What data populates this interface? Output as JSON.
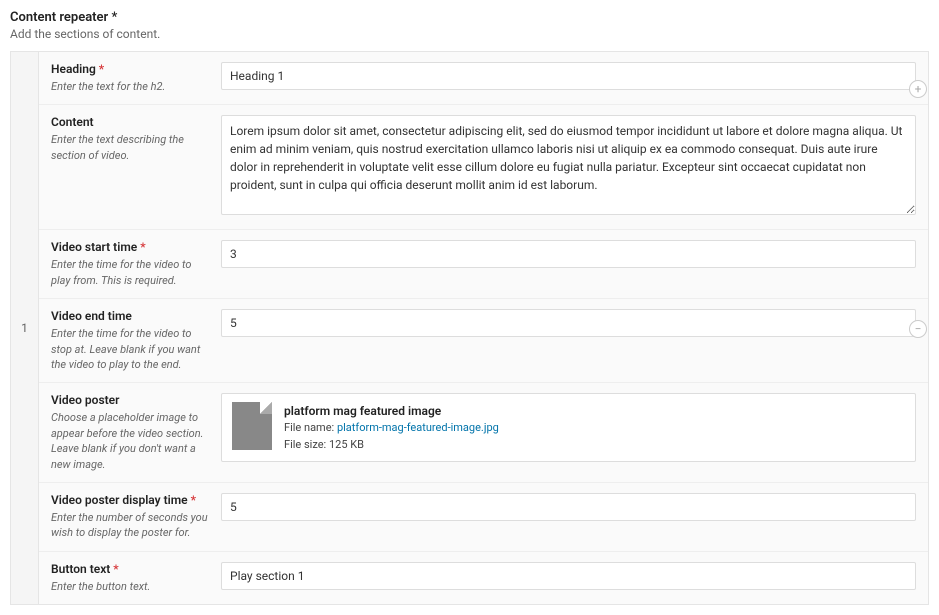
{
  "section": {
    "title": "Content repeater",
    "required_marker": "*",
    "desc": "Add the sections of content."
  },
  "row_index": "1",
  "fields": {
    "heading": {
      "label": "Heading",
      "required": true,
      "hint": "Enter the text for the h2.",
      "value": "Heading 1"
    },
    "content": {
      "label": "Content",
      "required": false,
      "hint": "Enter the text describing the section of video.",
      "value": "Lorem ipsum dolor sit amet, consectetur adipiscing elit, sed do eiusmod tempor incididunt ut labore et dolore magna aliqua. Ut enim ad minim veniam, quis nostrud exercitation ullamco laboris nisi ut aliquip ex ea commodo consequat. Duis aute irure dolor in reprehenderit in voluptate velit esse cillum dolore eu fugiat nulla pariatur. Excepteur sint occaecat cupidatat non proident, sunt in culpa qui officia deserunt mollit anim id est laborum."
    },
    "video_start": {
      "label": "Video start time",
      "required": true,
      "hint": "Enter the time for the video to play from. This is required.",
      "value": "3"
    },
    "video_end": {
      "label": "Video end time",
      "required": false,
      "hint": "Enter the time for the video to stop at. Leave blank if you want the video to play to the end.",
      "value": "5"
    },
    "poster": {
      "label": "Video poster",
      "required": false,
      "hint": "Choose a placeholder image to appear before the video section. Leave blank if you don't want a new image.",
      "file": {
        "title": "platform mag featured image",
        "filename_label": "File name:",
        "filename": "platform-mag-featured-image.jpg",
        "filesize_label": "File size:",
        "filesize": "125 KB"
      }
    },
    "poster_time": {
      "label": "Video poster display time",
      "required": true,
      "hint": "Enter the number of seconds you wish to display the poster for.",
      "value": "5"
    },
    "button_text": {
      "label": "Button text",
      "required": true,
      "hint": "Enter the button text.",
      "value": "Play section 1"
    }
  },
  "actions": {
    "add": "+",
    "remove": "−"
  }
}
